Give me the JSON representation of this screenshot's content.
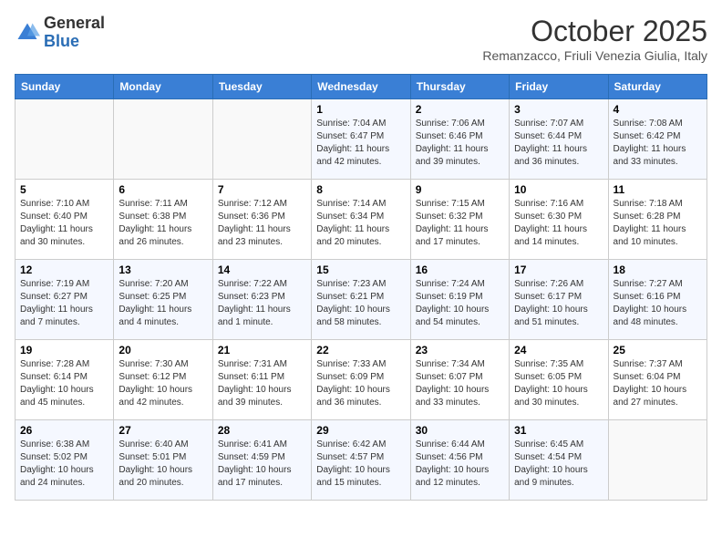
{
  "header": {
    "logo_general": "General",
    "logo_blue": "Blue",
    "month_title": "October 2025",
    "location": "Remanzacco, Friuli Venezia Giulia, Italy"
  },
  "days_of_week": [
    "Sunday",
    "Monday",
    "Tuesday",
    "Wednesday",
    "Thursday",
    "Friday",
    "Saturday"
  ],
  "weeks": [
    [
      {
        "day": "",
        "info": ""
      },
      {
        "day": "",
        "info": ""
      },
      {
        "day": "",
        "info": ""
      },
      {
        "day": "1",
        "info": "Sunrise: 7:04 AM\nSunset: 6:47 PM\nDaylight: 11 hours and 42 minutes."
      },
      {
        "day": "2",
        "info": "Sunrise: 7:06 AM\nSunset: 6:46 PM\nDaylight: 11 hours and 39 minutes."
      },
      {
        "day": "3",
        "info": "Sunrise: 7:07 AM\nSunset: 6:44 PM\nDaylight: 11 hours and 36 minutes."
      },
      {
        "day": "4",
        "info": "Sunrise: 7:08 AM\nSunset: 6:42 PM\nDaylight: 11 hours and 33 minutes."
      }
    ],
    [
      {
        "day": "5",
        "info": "Sunrise: 7:10 AM\nSunset: 6:40 PM\nDaylight: 11 hours and 30 minutes."
      },
      {
        "day": "6",
        "info": "Sunrise: 7:11 AM\nSunset: 6:38 PM\nDaylight: 11 hours and 26 minutes."
      },
      {
        "day": "7",
        "info": "Sunrise: 7:12 AM\nSunset: 6:36 PM\nDaylight: 11 hours and 23 minutes."
      },
      {
        "day": "8",
        "info": "Sunrise: 7:14 AM\nSunset: 6:34 PM\nDaylight: 11 hours and 20 minutes."
      },
      {
        "day": "9",
        "info": "Sunrise: 7:15 AM\nSunset: 6:32 PM\nDaylight: 11 hours and 17 minutes."
      },
      {
        "day": "10",
        "info": "Sunrise: 7:16 AM\nSunset: 6:30 PM\nDaylight: 11 hours and 14 minutes."
      },
      {
        "day": "11",
        "info": "Sunrise: 7:18 AM\nSunset: 6:28 PM\nDaylight: 11 hours and 10 minutes."
      }
    ],
    [
      {
        "day": "12",
        "info": "Sunrise: 7:19 AM\nSunset: 6:27 PM\nDaylight: 11 hours and 7 minutes."
      },
      {
        "day": "13",
        "info": "Sunrise: 7:20 AM\nSunset: 6:25 PM\nDaylight: 11 hours and 4 minutes."
      },
      {
        "day": "14",
        "info": "Sunrise: 7:22 AM\nSunset: 6:23 PM\nDaylight: 11 hours and 1 minute."
      },
      {
        "day": "15",
        "info": "Sunrise: 7:23 AM\nSunset: 6:21 PM\nDaylight: 10 hours and 58 minutes."
      },
      {
        "day": "16",
        "info": "Sunrise: 7:24 AM\nSunset: 6:19 PM\nDaylight: 10 hours and 54 minutes."
      },
      {
        "day": "17",
        "info": "Sunrise: 7:26 AM\nSunset: 6:17 PM\nDaylight: 10 hours and 51 minutes."
      },
      {
        "day": "18",
        "info": "Sunrise: 7:27 AM\nSunset: 6:16 PM\nDaylight: 10 hours and 48 minutes."
      }
    ],
    [
      {
        "day": "19",
        "info": "Sunrise: 7:28 AM\nSunset: 6:14 PM\nDaylight: 10 hours and 45 minutes."
      },
      {
        "day": "20",
        "info": "Sunrise: 7:30 AM\nSunset: 6:12 PM\nDaylight: 10 hours and 42 minutes."
      },
      {
        "day": "21",
        "info": "Sunrise: 7:31 AM\nSunset: 6:11 PM\nDaylight: 10 hours and 39 minutes."
      },
      {
        "day": "22",
        "info": "Sunrise: 7:33 AM\nSunset: 6:09 PM\nDaylight: 10 hours and 36 minutes."
      },
      {
        "day": "23",
        "info": "Sunrise: 7:34 AM\nSunset: 6:07 PM\nDaylight: 10 hours and 33 minutes."
      },
      {
        "day": "24",
        "info": "Sunrise: 7:35 AM\nSunset: 6:05 PM\nDaylight: 10 hours and 30 minutes."
      },
      {
        "day": "25",
        "info": "Sunrise: 7:37 AM\nSunset: 6:04 PM\nDaylight: 10 hours and 27 minutes."
      }
    ],
    [
      {
        "day": "26",
        "info": "Sunrise: 6:38 AM\nSunset: 5:02 PM\nDaylight: 10 hours and 24 minutes."
      },
      {
        "day": "27",
        "info": "Sunrise: 6:40 AM\nSunset: 5:01 PM\nDaylight: 10 hours and 20 minutes."
      },
      {
        "day": "28",
        "info": "Sunrise: 6:41 AM\nSunset: 4:59 PM\nDaylight: 10 hours and 17 minutes."
      },
      {
        "day": "29",
        "info": "Sunrise: 6:42 AM\nSunset: 4:57 PM\nDaylight: 10 hours and 15 minutes."
      },
      {
        "day": "30",
        "info": "Sunrise: 6:44 AM\nSunset: 4:56 PM\nDaylight: 10 hours and 12 minutes."
      },
      {
        "day": "31",
        "info": "Sunrise: 6:45 AM\nSunset: 4:54 PM\nDaylight: 10 hours and 9 minutes."
      },
      {
        "day": "",
        "info": ""
      }
    ]
  ]
}
